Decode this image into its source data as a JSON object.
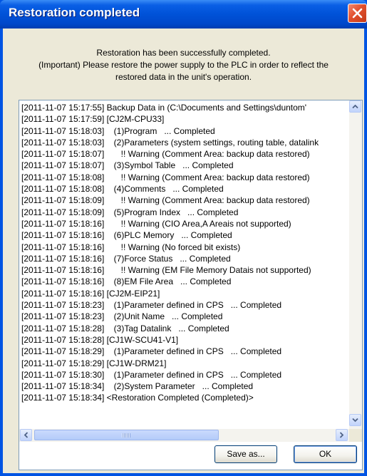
{
  "window": {
    "title": "Restoration completed"
  },
  "message": {
    "lines": [
      "Restoration has been successfully completed.",
      "(Important) Please restore the power supply to the PLC in order to reflect the",
      "restored data in the unit's operation."
    ]
  },
  "log": {
    "lines": [
      "[2011-11-07 15:17:55] Backup Data in (C:\\Documents and Settings\\duntom'",
      "[2011-11-07 15:17:59] [CJ2M-CPU33]",
      "[2011-11-07 15:18:03]    (1)Program   ... Completed",
      "[2011-11-07 15:18:03]    (2)Parameters (system settings, routing table, datalink",
      "[2011-11-07 15:18:07]       !! Warning (Comment Area: backup data restored)",
      "[2011-11-07 15:18:07]    (3)Symbol Table   ... Completed",
      "[2011-11-07 15:18:08]       !! Warning (Comment Area: backup data restored)",
      "[2011-11-07 15:18:08]    (4)Comments   ... Completed",
      "[2011-11-07 15:18:09]       !! Warning (Comment Area: backup data restored)",
      "[2011-11-07 15:18:09]    (5)Program Index   ... Completed",
      "[2011-11-07 15:18:16]       !! Warning (CIO Area,A Areais not supported)",
      "[2011-11-07 15:18:16]    (6)PLC Memory   ... Completed",
      "[2011-11-07 15:18:16]       !! Warning (No forced bit exists)",
      "[2011-11-07 15:18:16]    (7)Force Status   ... Completed",
      "[2011-11-07 15:18:16]       !! Warning (EM File Memory Datais not supported)",
      "[2011-11-07 15:18:16]    (8)EM File Area   ... Completed",
      "[2011-11-07 15:18:16] [CJ2M-EIP21]",
      "[2011-11-07 15:18:23]    (1)Parameter defined in CPS   ... Completed",
      "[2011-11-07 15:18:23]    (2)Unit Name   ... Completed",
      "[2011-11-07 15:18:28]    (3)Tag Datalink   ... Completed",
      "[2011-11-07 15:18:28] [CJ1W-SCU41-V1]",
      "[2011-11-07 15:18:29]    (1)Parameter defined in CPS   ... Completed",
      "[2011-11-07 15:18:29] [CJ1W-DRM21]",
      "[2011-11-07 15:18:30]    (1)Parameter defined in CPS   ... Completed",
      "[2011-11-07 15:18:34]    (2)System Parameter   ... Completed",
      "[2011-11-07 15:18:34] <Restoration Completed (Completed)>"
    ]
  },
  "buttons": {
    "save_as": "Save as...",
    "ok": "OK"
  },
  "icons": {
    "close": "close-icon",
    "scroll_up": "arrow-up-icon",
    "scroll_down": "arrow-down-icon",
    "scroll_left": "arrow-left-icon",
    "scroll_right": "arrow-right-icon"
  },
  "colors": {
    "titlebar": "#0054e3",
    "dialog_bg": "#ece9d8",
    "close_button": "#e2502c"
  }
}
